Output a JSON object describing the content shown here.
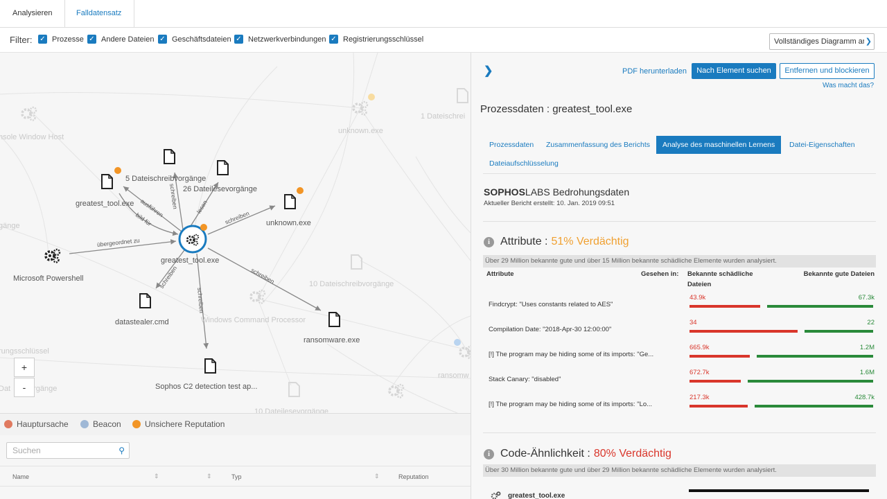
{
  "top_tabs": {
    "analyze": "Analysieren",
    "case_data": "Falldatensatz"
  },
  "filter": {
    "label": "Filter:",
    "items": [
      "Prozesse",
      "Andere Dateien",
      "Geschäftsdateien",
      "Netzwerkverbindungen",
      "Registrierungsschlüssel"
    ],
    "diagram_select": "Vollständiges Diagramm an"
  },
  "graph": {
    "nodes": {
      "center": "greatest_tool.exe",
      "greatest_tool_exe": "greatest_tool.exe",
      "write_ops_5": "5 Dateischreibvorgänge",
      "read_ops_26": "26 Dateilesevorgänge",
      "unknown_exe": "unknown.exe",
      "powershell": "Microsoft Powershell",
      "datastealer": "datastealer.cmd",
      "ransomware": "ransomware.exe",
      "sophos_c2": "Sophos C2 detection test ap..."
    },
    "faded": {
      "console_host": "nsole Window Host",
      "unknown_exe_bg": "unknown.exe",
      "file_write_1": "1 Dateischrei",
      "gaenge": "gänge",
      "file_write_10": "10 Dateischreibvorgänge",
      "win_cmd": "Windows Command Processor",
      "registry": "rungsschlüssel",
      "dat_vorgaenge": "Dat       vorgänge",
      "ransomw": "ransomw",
      "file_read_10": "10 Dateilesevorgänge"
    },
    "edges": {
      "execute": "ausführen",
      "built_for": "bild für",
      "write_1": "schreiben",
      "read": "lesen",
      "write_2": "schreiben",
      "parent": "übergeordnet zu",
      "write_3": "schreiben",
      "write_4": "schreiben",
      "write_5": "schreiben"
    },
    "zoom_in": "+",
    "zoom_out": "-"
  },
  "legend": {
    "root_cause": "Hauptursache",
    "beacon": "Beacon",
    "unsafe_reputation": "Unsichere Reputation"
  },
  "table": {
    "search_placeholder": "Suchen",
    "columns": [
      "Name",
      "Typ",
      "Reputation"
    ]
  },
  "panel": {
    "pdf_download": "PDF herunterladen",
    "search_element": "Nach Element suchen",
    "remove_block": "Entfernen und blockieren",
    "what_does_that": "Was macht das?",
    "title": "Prozessdaten : greatest_tool.exe",
    "tabs": [
      "Prozessdaten",
      "Zusammenfassung des Berichts",
      "Analyse des maschinellen Lernens",
      "Datei-Eigenschaften",
      "Dateiaufschlüsselung"
    ],
    "labs_bold": "SOPHOS",
    "labs_rest": "LABS Bedrohungsdaten",
    "report_created": "Aktueller Bericht erstellt: 10. Jan. 2019 09:51",
    "attributes": {
      "title": "Attribute",
      "colon": ":",
      "score": "51% Verdächtig",
      "score_color": "#f0a030",
      "summary": "Über 29 Million bekannte gute und über 15 Million bekannte schädliche Elemente wurden analysiert.",
      "col_attribute": "Attribute",
      "col_seen_in": "Gesehen in:",
      "col_malicious": "Bekannte schädliche Dateien",
      "col_good": "Bekannte gute Dateien",
      "rows": [
        {
          "label": "Findcrypt: \"Uses constants related to AES\"",
          "mal": "43.9k",
          "good": "67.3k",
          "mal_frac": 0.4,
          "good_frac": 0.6
        },
        {
          "label": "Compilation Date: \"2018-Apr-30 12:00:00\"",
          "mal": "34",
          "good": "22",
          "mal_frac": 0.61,
          "good_frac": 0.39
        },
        {
          "label": "[!] The program may be hiding some of its imports: \"Ge...",
          "mal": "665.9k",
          "good": "1.2M",
          "mal_frac": 0.34,
          "good_frac": 0.66
        },
        {
          "label": "Stack Canary: \"disabled\"",
          "mal": "672.7k",
          "good": "1.6M",
          "mal_frac": 0.29,
          "good_frac": 0.71
        },
        {
          "label": "[!] The program may be hiding some of its imports: \"Lo...",
          "mal": "217.3k",
          "good": "428.7k",
          "mal_frac": 0.33,
          "good_frac": 0.67
        }
      ]
    },
    "code_similarity": {
      "title": "Code-Ähnlichkeit",
      "colon": ":",
      "score": "80% Verdächtig",
      "score_color": "#d9362b",
      "summary": "Über 30 Million bekannte gute und über 29 Million bekannte schädliche Elemente wurden analysiert.",
      "first_row": "greatest_tool.exe"
    }
  }
}
